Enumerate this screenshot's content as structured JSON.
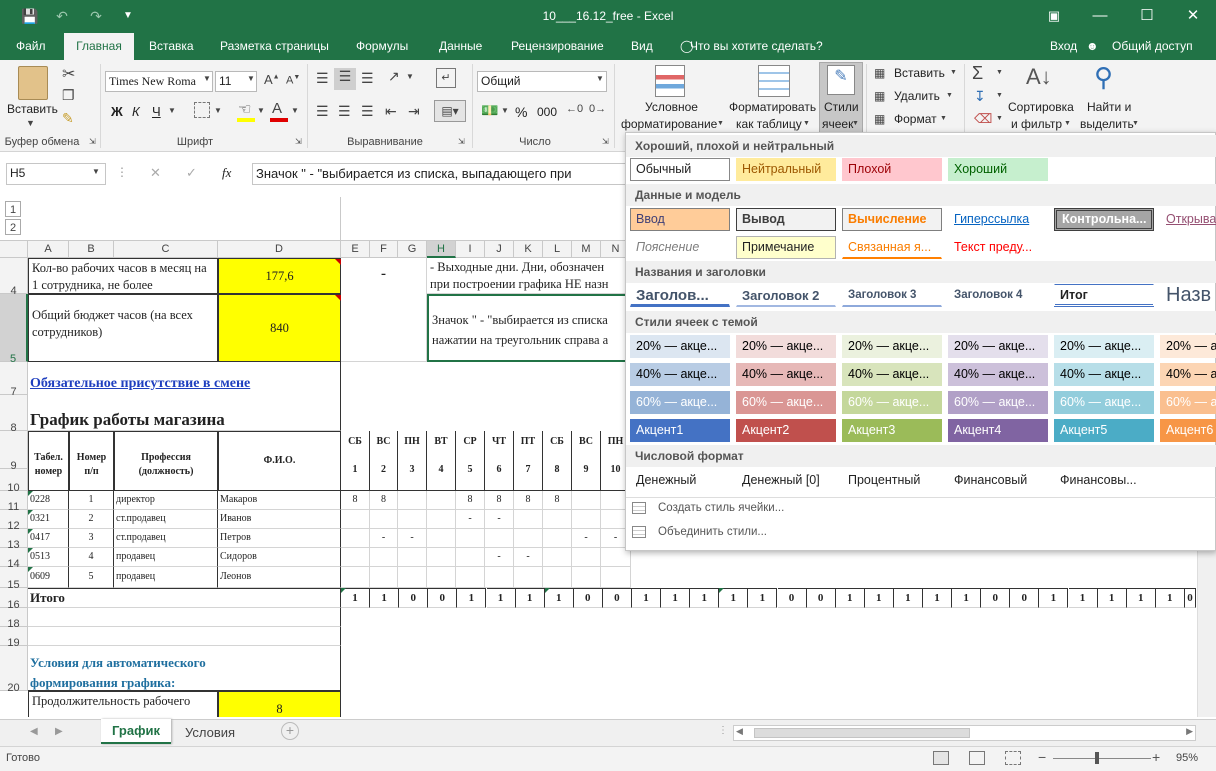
{
  "window": {
    "title": "10___16.12_free - Excel"
  },
  "tabs": [
    "Файл",
    "Главная",
    "Вставка",
    "Разметка страницы",
    "Формулы",
    "Данные",
    "Рецензирование",
    "Вид"
  ],
  "tell_me": "Что вы хотите сделать?",
  "signin": "Вход",
  "share": "Общий доступ",
  "ribbon": {
    "clipboard": {
      "paste": "Вставить",
      "label": "Буфер обмена"
    },
    "font": {
      "name": "Times New Roma",
      "size": "11",
      "bold": "Ж",
      "italic": "К",
      "underline": "Ч",
      "label": "Шрифт"
    },
    "alignment": {
      "label": "Выравнивание"
    },
    "number": {
      "format": "Общий",
      "label": "Число",
      "percent": "%",
      "thousands": "000"
    },
    "styles": {
      "conditional_1": "Условное",
      "conditional_2": "форматирование",
      "astable_1": "Форматировать",
      "astable_2": "как таблицу",
      "cellstyles_1": "Стили",
      "cellstyles_2": "ячеек"
    },
    "cells": {
      "insert": "Вставить",
      "delete": "Удалить",
      "format": "Формат"
    },
    "editing": {
      "sort_1": "Сортировка",
      "sort_2": "и фильтр",
      "find_1": "Найти и",
      "find_2": "выделить"
    }
  },
  "formula_bar": {
    "name_box": "H5",
    "fx": "fx",
    "content": "Значок \" - \"выбирается из списка, выпадающего при"
  },
  "columns": [
    "A",
    "B",
    "C",
    "D",
    "E",
    "F",
    "G",
    "H",
    "I",
    "J",
    "K",
    "L",
    "M",
    "N"
  ],
  "row_numbers": [
    "4",
    "5",
    "7",
    "8",
    "9",
    "10",
    "11",
    "12",
    "13",
    "14",
    "15",
    "16",
    "18",
    "19",
    "20"
  ],
  "sheet": {
    "a4": "Кол-во рабочих часов в месяц на 1 сотрудника, не более",
    "d4": "177,6",
    "ef4": "-",
    "h4": "- Выходные дни. Дни, обозначен",
    "h4b": "при построении графика НЕ назн",
    "a5_1": "Общий бюджет часов (на всех",
    "a5_2": "сотрудников)",
    "d5": "840",
    "h5_1": "Значок \" - \"выбирается из списка",
    "h5_2": "нажатии на треугольник справа а",
    "a7": "Обязательное присутствие в смене",
    "a8": "График работы магазина",
    "hdr_tab": [
      "Табел.",
      "номер"
    ],
    "hdr_num": [
      "Номер",
      "п/п"
    ],
    "hdr_prof": [
      "Профессия",
      "(должность)"
    ],
    "hdr_fio": "Ф.И.О.",
    "days": [
      "СБ",
      "ВС",
      "ПН",
      "ВТ",
      "СР",
      "ЧТ",
      "ПТ",
      "СБ",
      "ВС",
      "ПН"
    ],
    "daynums": [
      "1",
      "2",
      "3",
      "4",
      "5",
      "6",
      "7",
      "8",
      "9",
      "10"
    ],
    "employees": [
      {
        "tab": "0228",
        "n": "1",
        "prof": "директор",
        "fio": "Макаров",
        "d": [
          "8",
          "8",
          "",
          "",
          "8",
          "8",
          "8",
          "8",
          "",
          ""
        ]
      },
      {
        "tab": "0321",
        "n": "2",
        "prof": "ст.продавец",
        "fio": "Иванов",
        "d": [
          "",
          "",
          "",
          "",
          "-",
          "-",
          "",
          "",
          "",
          ""
        ]
      },
      {
        "tab": "0417",
        "n": "3",
        "prof": "ст.продавец",
        "fio": "Петров",
        "d": [
          "",
          "-",
          "-",
          "",
          "",
          "",
          "",
          "",
          "-",
          "-"
        ]
      },
      {
        "tab": "0513",
        "n": "4",
        "prof": "продавец",
        "fio": "Сидоров",
        "d": [
          "",
          "",
          "",
          "",
          "",
          "-",
          "-",
          "",
          "",
          ""
        ]
      },
      {
        "tab": "0609",
        "n": "5",
        "prof": "продавец",
        "fio": "Леонов",
        "d": [
          "",
          "",
          "",
          "",
          "",
          "",
          "",
          "",
          "",
          ""
        ]
      }
    ],
    "total_label": "Итого",
    "totals": [
      "1",
      "1",
      "0",
      "0",
      "1",
      "1",
      "1",
      "1",
      "0",
      "0",
      "1",
      "1",
      "1",
      "1",
      "1",
      "0",
      "0",
      "1",
      "1",
      "1",
      "1",
      "1",
      "0",
      "0",
      "1",
      "1",
      "1",
      "1",
      "1",
      "0"
    ],
    "a20_1": "Условия для автоматического",
    "a20_2": "формирования графика:",
    "a21": "Продолжительность рабочего",
    "d21": "8"
  },
  "gallery": {
    "sections": [
      "Хороший, плохой и нейтральный",
      "Данные и модель",
      "Названия и заголовки",
      "Стили ячеек с темой",
      "Числовой формат"
    ],
    "good_bad": [
      "Обычный",
      "Нейтральный",
      "Плохой",
      "Хороший"
    ],
    "data_model_1": [
      "Ввод",
      "Вывод",
      "Вычисление",
      "Гиперссылка",
      "Контрольна...",
      "Открыва"
    ],
    "data_model_2": [
      "Пояснение",
      "Примечание",
      "Связанная я...",
      "Текст преду..."
    ],
    "titles": [
      "Заголов...",
      "Заголовок 2",
      "Заголовок 3",
      "Заголовок 4",
      "Итог",
      "Назв"
    ],
    "accent20": [
      "20% — акце...",
      "20% — акце...",
      "20% — акце...",
      "20% — акце...",
      "20% — акце...",
      "20% — а"
    ],
    "accent40": [
      "40% — акце...",
      "40% — акце...",
      "40% — акце...",
      "40% — акце...",
      "40% — акце...",
      "40% — а"
    ],
    "accent60": [
      "60% — акце...",
      "60% — акце...",
      "60% — акце...",
      "60% — акце...",
      "60% — акце...",
      "60% — а"
    ],
    "accents": [
      "Акцент1",
      "Акцент2",
      "Акцент3",
      "Акцент4",
      "Акцент5",
      "Акцент6"
    ],
    "number_fmt": [
      "Денежный",
      "Денежный [0]",
      "Процентный",
      "Финансовый",
      "Финансовы..."
    ],
    "new_style": "Создать стиль ячейки...",
    "merge_styles": "Объединить стили..."
  },
  "sheet_tabs": [
    "График",
    "Условия"
  ],
  "status": {
    "ready": "Готово",
    "zoom": "95%"
  },
  "colors": {
    "excel_green": "#217346",
    "yellow_cell": "#ffff00"
  }
}
